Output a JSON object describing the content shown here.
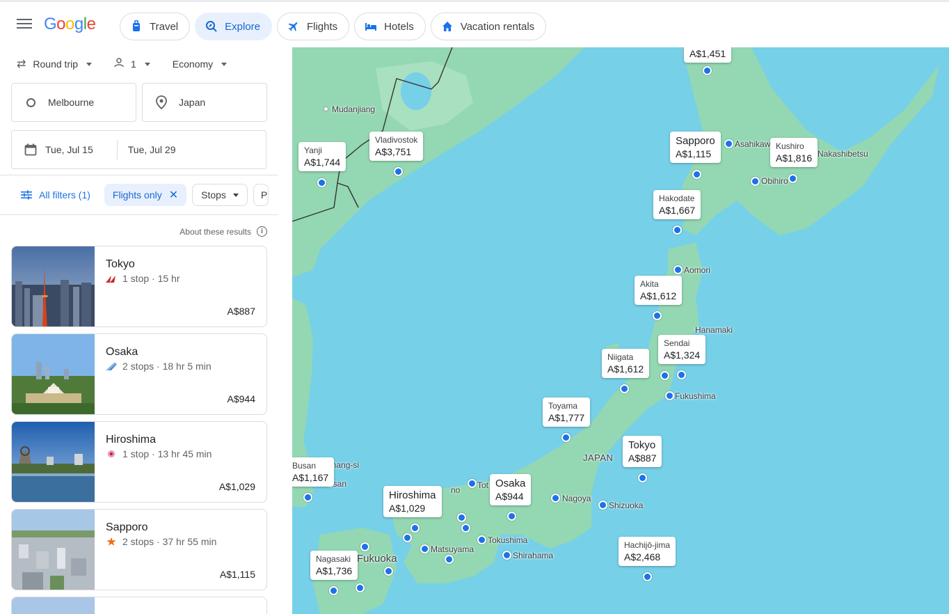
{
  "header": {
    "tabs": [
      {
        "label": "Travel"
      },
      {
        "label": "Explore"
      },
      {
        "label": "Flights"
      },
      {
        "label": "Hotels"
      },
      {
        "label": "Vacation rentals"
      }
    ]
  },
  "search": {
    "trip_type": "Round trip",
    "passengers": "1",
    "cabin": "Economy",
    "origin": "Melbourne",
    "destination": "Japan",
    "depart": "Tue, Jul 15",
    "return": "Tue, Jul 29"
  },
  "filters": {
    "all_filters": "All filters (1)",
    "flights_only": "Flights only",
    "stops": "Stops",
    "more": "P",
    "about": "About these results"
  },
  "results": [
    {
      "city": "Tokyo",
      "details": "1 stop · 15 hr",
      "price": "A$887"
    },
    {
      "city": "Osaka",
      "details": "2 stops · 18 hr 5 min",
      "price": "A$944"
    },
    {
      "city": "Hiroshima",
      "details": "1 stop · 13 hr 45 min",
      "price": "A$1,029"
    },
    {
      "city": "Sapporo",
      "details": "2 stops · 37 hr 55 min",
      "price": "A$1,115"
    }
  ],
  "map": {
    "price_labels": [
      {
        "name": "",
        "price": "A$1,451"
      },
      {
        "name": "Sapporo",
        "price": "A$1,115"
      },
      {
        "name": "Kushiro",
        "price": "A$1,816"
      },
      {
        "name": "Vladivostok",
        "price": "A$3,751"
      },
      {
        "name": "Yanji",
        "price": "A$1,744"
      },
      {
        "name": "Hakodate",
        "price": "A$1,667"
      },
      {
        "name": "Akita",
        "price": "A$1,612"
      },
      {
        "name": "Sendai",
        "price": "A$1,324"
      },
      {
        "name": "Niigata",
        "price": "A$1,612"
      },
      {
        "name": "Toyama",
        "price": "A$1,777"
      },
      {
        "name": "Tokyo",
        "price": "A$887"
      },
      {
        "name": "Busan",
        "price": "A$1,167"
      },
      {
        "name": "Osaka",
        "price": "A$944"
      },
      {
        "name": "Hiroshima",
        "price": "A$1,029"
      },
      {
        "name": "Hachijō-jima",
        "price": "A$2,468"
      },
      {
        "name": "Nagasaki",
        "price": "A$1,736"
      }
    ],
    "place_names": {
      "mudanjiang": "Mudanjiang",
      "asahikawa": "Asahikaw",
      "nakashibetsu": "Nakashibetsu",
      "obihiro": "Obihiro",
      "aomori": "Aomori",
      "hanamaki": "Hanamaki",
      "fukushima": "Fukushima",
      "japan": "JAPAN",
      "nagoya": "Nagoya",
      "shizuoka": "Shizuoka",
      "tokushima": "Tokushima",
      "shirahama": "Shirahama",
      "matsuyama": "Matsuyama",
      "fukuoka": "Fukuoka",
      "pohang": "ohang-si",
      "usan": "usan",
      "tot": "Tot",
      "no": "no"
    }
  }
}
